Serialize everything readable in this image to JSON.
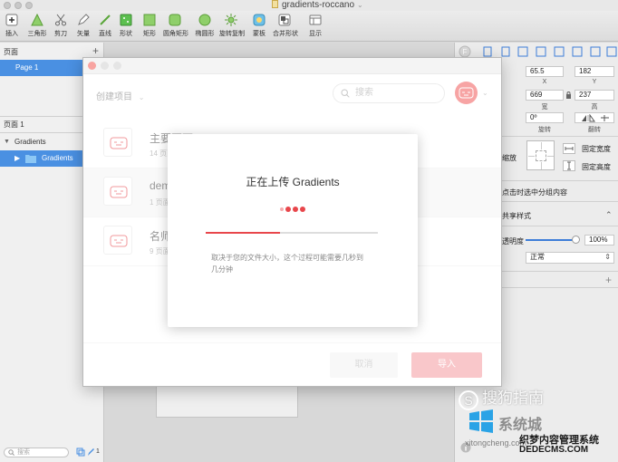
{
  "window": {
    "title": "gradients-roccano"
  },
  "toolbar": {
    "items": [
      {
        "label": "插入",
        "icon": "plus-icon"
      },
      {
        "label": "三角形",
        "icon": "triangle-icon"
      },
      {
        "label": "剪刀",
        "icon": "scissors-icon"
      },
      {
        "label": "矢量",
        "icon": "pen-icon"
      },
      {
        "label": "直线",
        "icon": "line-icon"
      },
      {
        "label": "形状",
        "icon": "shape-icon"
      },
      {
        "label": "矩形",
        "icon": "rectangle-icon"
      },
      {
        "label": "圆角矩形",
        "icon": "rounded-rectangle-icon"
      },
      {
        "label": "椭圆形",
        "icon": "ellipse-icon"
      },
      {
        "label": "旋转复制",
        "icon": "rotate-copy-icon"
      },
      {
        "label": "蒙板",
        "icon": "mask-icon"
      },
      {
        "label": "合并形状",
        "icon": "combine-shapes-icon"
      },
      {
        "label": "显示",
        "icon": "view-icon"
      }
    ]
  },
  "sidebar": {
    "pages_header": "页面",
    "pages": [
      "Page 1"
    ],
    "layers_header": "页面 1",
    "tree": [
      {
        "label": "Gradients",
        "selected": false
      },
      {
        "label": "Gradients",
        "selected": true
      }
    ],
    "search_placeholder": "搜索",
    "footer_count": "1"
  },
  "inspector": {
    "x_value": "65.5",
    "x_label": "X",
    "y_value": "182",
    "y_label": "Y",
    "w_value": "669",
    "w_label": "宽",
    "h_value": "237",
    "h_label": "高",
    "rotate_value": "0º",
    "rotate_label": "旋转",
    "flip_label": "翻转",
    "fix_width": "固定宽度",
    "fix_height": "固定高度",
    "resize_label": "缩放",
    "group_select": "点击时选中分组内容",
    "shared_style": "共享样式",
    "opacity_label": "透明度",
    "opacity_value": "100%",
    "blend_value": "正常",
    "opacity_fraction": 1.0
  },
  "dialog": {
    "project_dropdown": "创建项目",
    "search_placeholder": "搜索",
    "projects": [
      {
        "name": "主要页面",
        "meta": "14 页面"
      },
      {
        "name": "dem",
        "meta": "1 页面"
      },
      {
        "name": "名师",
        "meta": "9 页面"
      }
    ],
    "cancel_label": "取消",
    "import_label": "导入"
  },
  "upload": {
    "title": "正在上传 Gradients",
    "description": "取决于您的文件大小，这个过程可能需要几秒到几分钟",
    "progress": 0.43
  },
  "watermarks": {
    "sogou": "搜狗指南",
    "xitong": "系统城",
    "xitong_url": "xitongcheng.com",
    "dede_name": "织梦内容管理系统",
    "dede_url": "DEDECMS.COM"
  },
  "colors": {
    "accent_red": "#e8464b",
    "selection_blue": "#4a90e2",
    "import_button": "#f59a9f"
  }
}
